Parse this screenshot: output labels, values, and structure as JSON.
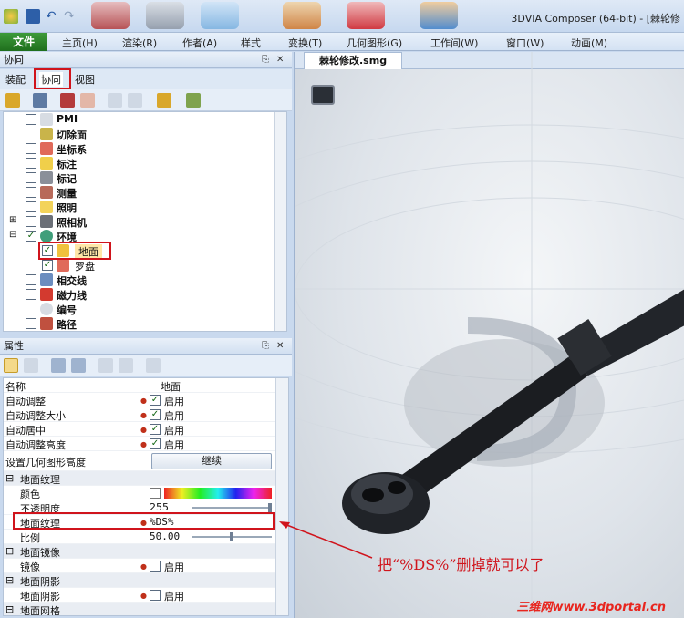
{
  "app": {
    "title": "3DVIA Composer (64-bit) - [棘轮修"
  },
  "menu": {
    "file": "文件",
    "items": [
      "主页(H)",
      "渲染(R)",
      "作者(A)",
      "样式",
      "变换(T)",
      "几何图形(G)",
      "工作间(W)",
      "窗口(W)",
      "动画(M)"
    ]
  },
  "collab_panel": {
    "title": "协同",
    "tabs": [
      "装配",
      "协同",
      "视图"
    ],
    "active_tab": "协同"
  },
  "tree": {
    "items": [
      {
        "label": "PMI",
        "checked": false
      },
      {
        "label": "切除面",
        "checked": false
      },
      {
        "label": "坐标系",
        "checked": false
      },
      {
        "label": "标注",
        "checked": false
      },
      {
        "label": "标记",
        "checked": false
      },
      {
        "label": "测量",
        "checked": false
      },
      {
        "label": "照明",
        "checked": false
      },
      {
        "label": "照相机",
        "checked": false
      },
      {
        "label": "环境",
        "checked": true
      },
      {
        "label": "地面",
        "checked": true
      },
      {
        "label": "罗盘",
        "checked": true
      },
      {
        "label": "相交线",
        "checked": false
      },
      {
        "label": "磁力线",
        "checked": false
      },
      {
        "label": "编号",
        "checked": false
      },
      {
        "label": "路径",
        "checked": false
      }
    ]
  },
  "props_panel": {
    "title": "属性",
    "rows": [
      {
        "name": "名称",
        "value": "地面",
        "kind": "text"
      },
      {
        "name": "自动调整",
        "value": "启用",
        "kind": "check"
      },
      {
        "name": "自动调整大小",
        "value": "启用",
        "kind": "check"
      },
      {
        "name": "自动居中",
        "value": "启用",
        "kind": "check"
      },
      {
        "name": "自动调整高度",
        "value": "启用",
        "kind": "check"
      },
      {
        "name": "设置几何图形高度",
        "value": "继续",
        "kind": "button"
      },
      {
        "name": "地面纹理",
        "value": "",
        "kind": "category"
      },
      {
        "name": "颜色",
        "value": "",
        "kind": "color"
      },
      {
        "name": "不透明度",
        "value": "255",
        "kind": "slider"
      },
      {
        "name": "地面纹理",
        "value": "%DS%",
        "kind": "text"
      },
      {
        "name": "比例",
        "value": "50.00",
        "kind": "slider"
      },
      {
        "name": "地面镜像",
        "value": "",
        "kind": "category"
      },
      {
        "name": "镜像",
        "value": "启用",
        "kind": "uncheck"
      },
      {
        "name": "地面阴影",
        "value": "",
        "kind": "category"
      },
      {
        "name": "地面阴影",
        "value": "启用",
        "kind": "uncheck"
      },
      {
        "name": "地面网格",
        "value": "",
        "kind": "category"
      }
    ]
  },
  "viewport": {
    "tab_label": "棘轮修改.smg"
  },
  "annotation": {
    "text": "把“%DS%”删掉就可以了"
  },
  "watermark": {
    "text": "三维网www.3dportal.cn"
  },
  "colors": {
    "accent_red": "#d0141c",
    "file_green": "#2e8a2c"
  }
}
